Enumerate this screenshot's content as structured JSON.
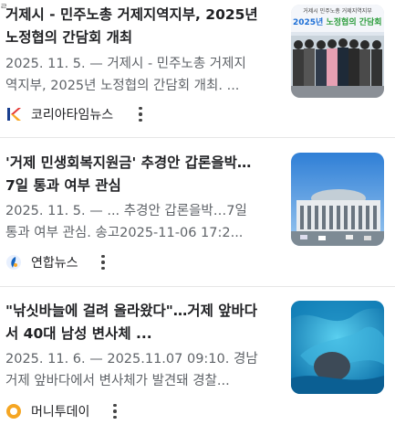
{
  "articles": [
    {
      "title_lines": [
        "거제시 - 민주노총 거제지역지부, 2025년",
        "노정협의 간담회 개최"
      ],
      "snippet_lines": [
        "2025. 11. 5. — 거제시 - 민주노총 거제지",
        "역지부, 2025년 노정협의 간담회 개최. ..."
      ],
      "source": "코리아타임뉴스",
      "thumb_banner_small": "거제시  민주노총 거제지역지부",
      "thumb_banner_year": "2025년",
      "thumb_banner_text": "노정협의 간담회"
    },
    {
      "title_lines": [
        "'거제 민생회복지원금' 추경안 갑론을박…",
        "7일 통과 여부 관심"
      ],
      "snippet_lines": [
        "2025. 11. 5. — ... 추경안 갑론을박…7일",
        "통과 여부 관심. 송고2025-11-06 17:2..."
      ],
      "source": "연합뉴스"
    },
    {
      "title_lines": [
        "\"낚싯바늘에 걸려 올라왔다\"…거제 앞바다",
        "서 40대 남성 변사체 ..."
      ],
      "snippet_lines": [
        "2025. 11. 6. — 2025.11.07 09:10. 경남",
        "거제 앞바다에서 변사체가 발견돼 경찰..."
      ],
      "source": "머니투데이"
    }
  ],
  "colors": {
    "title": "#202124",
    "snippet": "#5f6368",
    "divider": "#e6e6e6",
    "banner_year": "#1d6fd6",
    "banner_green": "#2e9e3e",
    "ocean": "#1a8fc4"
  }
}
